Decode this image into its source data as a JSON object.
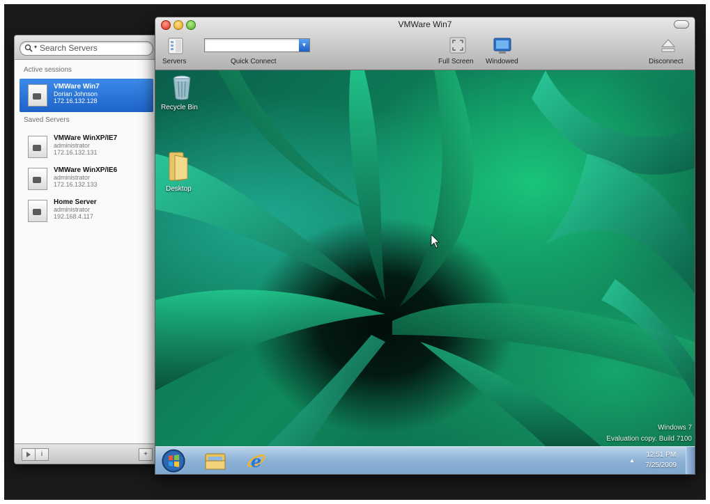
{
  "servers_panel": {
    "search": {
      "placeholder": "Search Servers"
    },
    "active_header": "Active sessions",
    "saved_header": "Saved Servers",
    "active_sessions": [
      {
        "name": "VMWare Win7",
        "user": "Dorian Johnson",
        "ip": "172.16.132.128"
      }
    ],
    "saved_servers": [
      {
        "name": "VMWare WinXP/IE7",
        "user": "administrator",
        "ip": "172.16.132.131"
      },
      {
        "name": "VMWare WinXP/IE6",
        "user": "administrator",
        "ip": "172.16.132.133"
      },
      {
        "name": "Home Server",
        "user": "administrator",
        "ip": "192.168.4.117"
      }
    ],
    "bottom_bar": {
      "info_label": "i",
      "add_label": "+"
    }
  },
  "window": {
    "title": "VMWare Win7",
    "toolbar": {
      "servers_label": "Servers",
      "quick_connect_label": "Quick Connect",
      "quick_connect_value": "",
      "full_screen_label": "Full Screen",
      "windowed_label": "Windowed",
      "disconnect_label": "Disconnect"
    }
  },
  "desktop": {
    "icons": [
      {
        "label": "Recycle Bin"
      },
      {
        "label": "Desktop"
      }
    ],
    "watermark_line1": "Windows 7",
    "watermark_line2": "Evaluation copy. Build 7100",
    "clock_time": "12:51 PM",
    "clock_date": "7/25/2009"
  },
  "colors": {
    "selection_blue": "#2a72d8",
    "taskbar_blue": "#8cb1d6",
    "wallpaper_green": "#0f8a5d"
  },
  "icons": {
    "taskbar": [
      "windows-start-icon",
      "explorer-folder-icon",
      "internet-explorer-icon"
    ]
  }
}
